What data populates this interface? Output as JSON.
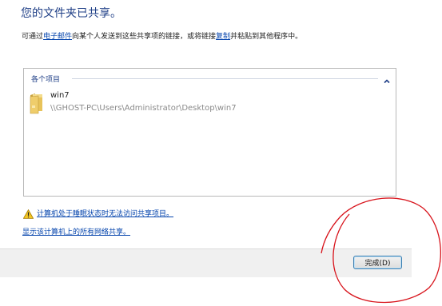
{
  "dialog": {
    "title": "您的文件夹已共享。",
    "description": {
      "prefix": "可通过",
      "email_link": "电子邮件",
      "middle": "向某个人发送到这些共享项的链接，或将链接",
      "copy_link": "复制",
      "suffix": "并粘贴到其他程序中。"
    }
  },
  "items": {
    "header": "各个项目",
    "list": [
      {
        "name": "win7",
        "path": "\\\\GHOST-PC\\Users\\Administrator\\Desktop\\win7",
        "icon": "folder-icon"
      }
    ]
  },
  "links": {
    "sleep_warning": "计算机处于睡眠状态时无法访问共享项目。",
    "show_all_shares": "显示该计算机上的所有网络共享。"
  },
  "footer": {
    "done_label": "完成(D)"
  },
  "colors": {
    "title": "#1e3e86",
    "link": "#0645ad",
    "annotation_circle": "#d8141c"
  }
}
